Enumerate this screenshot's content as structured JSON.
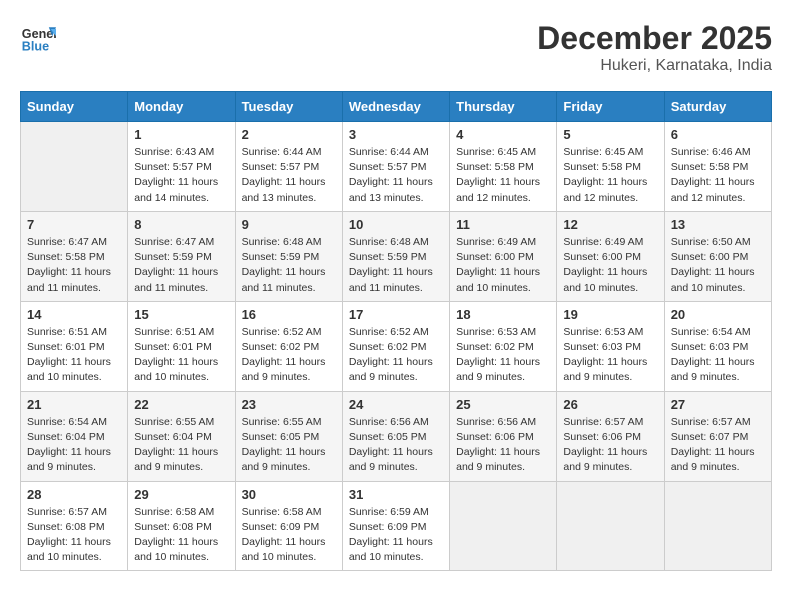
{
  "header": {
    "logo_general": "General",
    "logo_blue": "Blue",
    "month": "December 2025",
    "location": "Hukeri, Karnataka, India"
  },
  "weekdays": [
    "Sunday",
    "Monday",
    "Tuesday",
    "Wednesday",
    "Thursday",
    "Friday",
    "Saturday"
  ],
  "weeks": [
    [
      {
        "day": "",
        "empty": true
      },
      {
        "day": "1",
        "sunrise": "6:43 AM",
        "sunset": "5:57 PM",
        "daylight": "11 hours and 14 minutes."
      },
      {
        "day": "2",
        "sunrise": "6:44 AM",
        "sunset": "5:57 PM",
        "daylight": "11 hours and 13 minutes."
      },
      {
        "day": "3",
        "sunrise": "6:44 AM",
        "sunset": "5:57 PM",
        "daylight": "11 hours and 13 minutes."
      },
      {
        "day": "4",
        "sunrise": "6:45 AM",
        "sunset": "5:58 PM",
        "daylight": "11 hours and 12 minutes."
      },
      {
        "day": "5",
        "sunrise": "6:45 AM",
        "sunset": "5:58 PM",
        "daylight": "11 hours and 12 minutes."
      },
      {
        "day": "6",
        "sunrise": "6:46 AM",
        "sunset": "5:58 PM",
        "daylight": "11 hours and 12 minutes."
      }
    ],
    [
      {
        "day": "7",
        "sunrise": "6:47 AM",
        "sunset": "5:58 PM",
        "daylight": "11 hours and 11 minutes."
      },
      {
        "day": "8",
        "sunrise": "6:47 AM",
        "sunset": "5:59 PM",
        "daylight": "11 hours and 11 minutes."
      },
      {
        "day": "9",
        "sunrise": "6:48 AM",
        "sunset": "5:59 PM",
        "daylight": "11 hours and 11 minutes."
      },
      {
        "day": "10",
        "sunrise": "6:48 AM",
        "sunset": "5:59 PM",
        "daylight": "11 hours and 11 minutes."
      },
      {
        "day": "11",
        "sunrise": "6:49 AM",
        "sunset": "6:00 PM",
        "daylight": "11 hours and 10 minutes."
      },
      {
        "day": "12",
        "sunrise": "6:49 AM",
        "sunset": "6:00 PM",
        "daylight": "11 hours and 10 minutes."
      },
      {
        "day": "13",
        "sunrise": "6:50 AM",
        "sunset": "6:00 PM",
        "daylight": "11 hours and 10 minutes."
      }
    ],
    [
      {
        "day": "14",
        "sunrise": "6:51 AM",
        "sunset": "6:01 PM",
        "daylight": "11 hours and 10 minutes."
      },
      {
        "day": "15",
        "sunrise": "6:51 AM",
        "sunset": "6:01 PM",
        "daylight": "11 hours and 10 minutes."
      },
      {
        "day": "16",
        "sunrise": "6:52 AM",
        "sunset": "6:02 PM",
        "daylight": "11 hours and 9 minutes."
      },
      {
        "day": "17",
        "sunrise": "6:52 AM",
        "sunset": "6:02 PM",
        "daylight": "11 hours and 9 minutes."
      },
      {
        "day": "18",
        "sunrise": "6:53 AM",
        "sunset": "6:02 PM",
        "daylight": "11 hours and 9 minutes."
      },
      {
        "day": "19",
        "sunrise": "6:53 AM",
        "sunset": "6:03 PM",
        "daylight": "11 hours and 9 minutes."
      },
      {
        "day": "20",
        "sunrise": "6:54 AM",
        "sunset": "6:03 PM",
        "daylight": "11 hours and 9 minutes."
      }
    ],
    [
      {
        "day": "21",
        "sunrise": "6:54 AM",
        "sunset": "6:04 PM",
        "daylight": "11 hours and 9 minutes."
      },
      {
        "day": "22",
        "sunrise": "6:55 AM",
        "sunset": "6:04 PM",
        "daylight": "11 hours and 9 minutes."
      },
      {
        "day": "23",
        "sunrise": "6:55 AM",
        "sunset": "6:05 PM",
        "daylight": "11 hours and 9 minutes."
      },
      {
        "day": "24",
        "sunrise": "6:56 AM",
        "sunset": "6:05 PM",
        "daylight": "11 hours and 9 minutes."
      },
      {
        "day": "25",
        "sunrise": "6:56 AM",
        "sunset": "6:06 PM",
        "daylight": "11 hours and 9 minutes."
      },
      {
        "day": "26",
        "sunrise": "6:57 AM",
        "sunset": "6:06 PM",
        "daylight": "11 hours and 9 minutes."
      },
      {
        "day": "27",
        "sunrise": "6:57 AM",
        "sunset": "6:07 PM",
        "daylight": "11 hours and 9 minutes."
      }
    ],
    [
      {
        "day": "28",
        "sunrise": "6:57 AM",
        "sunset": "6:08 PM",
        "daylight": "11 hours and 10 minutes."
      },
      {
        "day": "29",
        "sunrise": "6:58 AM",
        "sunset": "6:08 PM",
        "daylight": "11 hours and 10 minutes."
      },
      {
        "day": "30",
        "sunrise": "6:58 AM",
        "sunset": "6:09 PM",
        "daylight": "11 hours and 10 minutes."
      },
      {
        "day": "31",
        "sunrise": "6:59 AM",
        "sunset": "6:09 PM",
        "daylight": "11 hours and 10 minutes."
      },
      {
        "day": "",
        "empty": true
      },
      {
        "day": "",
        "empty": true
      },
      {
        "day": "",
        "empty": true
      }
    ]
  ],
  "labels": {
    "sunrise": "Sunrise:",
    "sunset": "Sunset:",
    "daylight": "Daylight:"
  }
}
